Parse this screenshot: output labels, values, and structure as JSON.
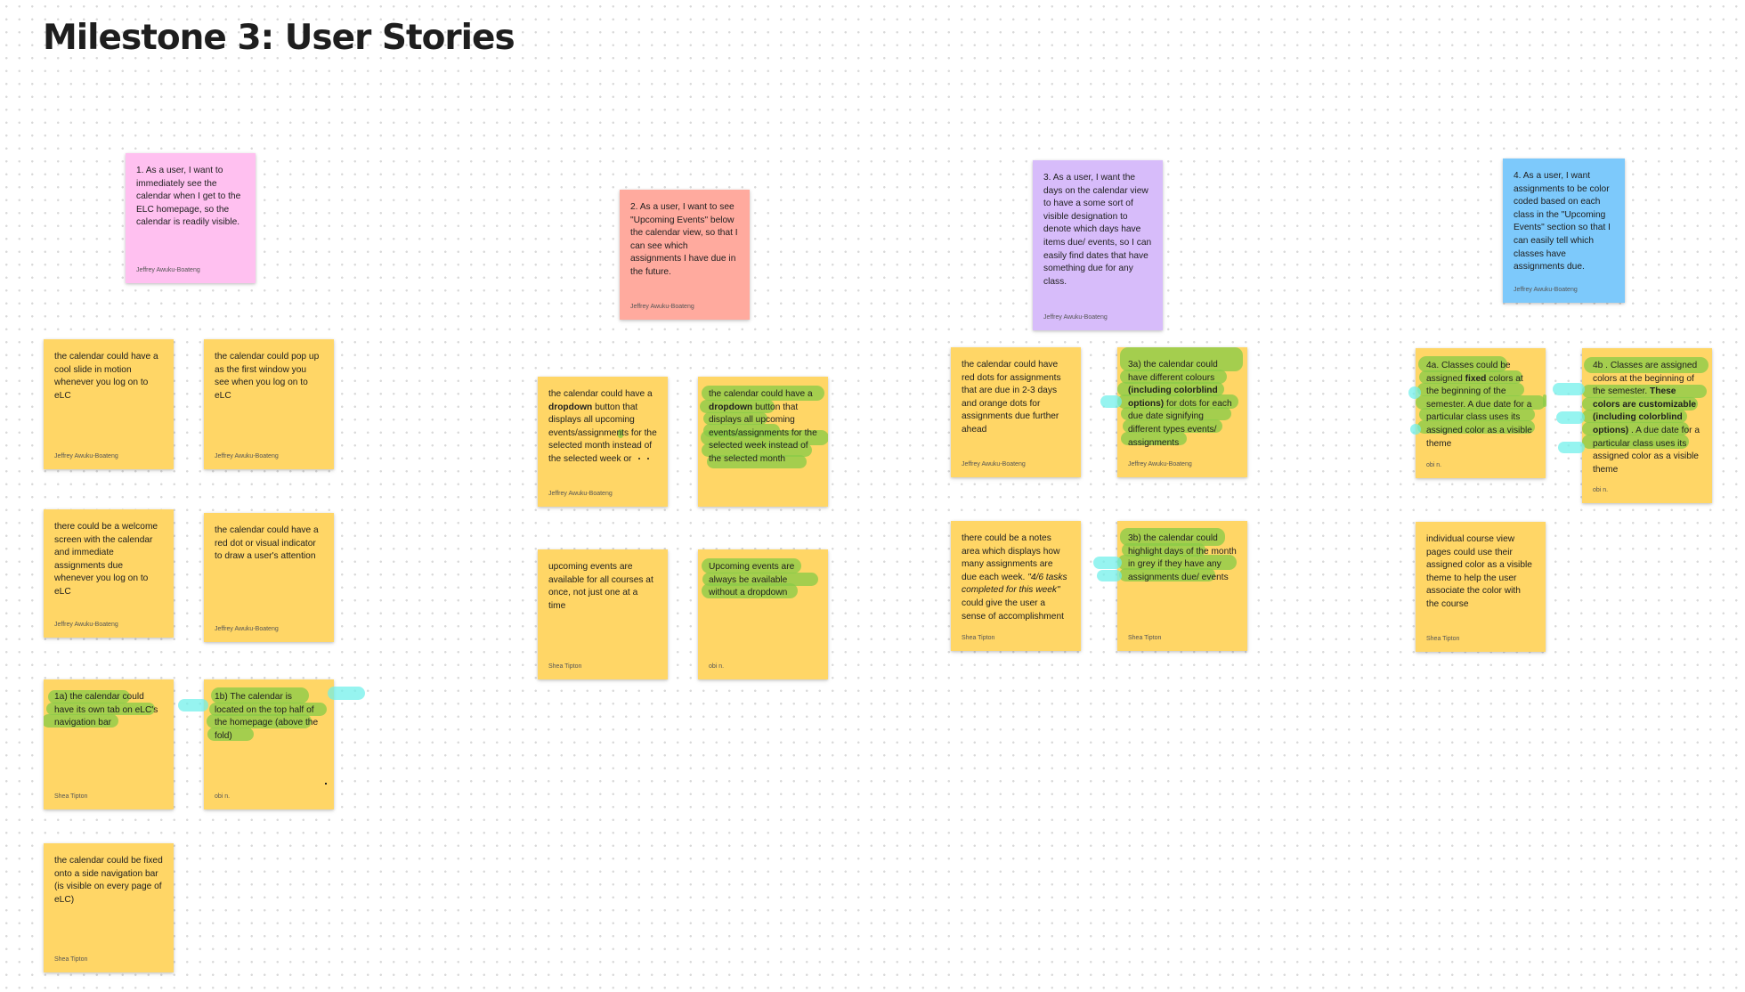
{
  "board": {
    "title": "Milestone 3: User Stories"
  },
  "stories": [
    {
      "text": "1. As a user, I want to immediately see the calendar when I get to the ELC homepage, so the calendar is readily visible.",
      "author": "Jeffrey Awuku-Boateng"
    },
    {
      "text": "2. As a user, I want to see \"Upcoming Events\" below the calendar view, so that I can see which assignments I have due in the future.",
      "author": "Jeffrey Awuku-Boateng"
    },
    {
      "text": "3. As a user, I want the days on the calendar view to have a some sort of visible designation to denote which days have items due/ events, so I can easily find dates that have something due for any class.",
      "author": "Jeffrey Awuku-Boateng"
    },
    {
      "text": "4. As a user, I want assignments to be color coded based on each class in the \"Upcoming Events\" section so that I can easily tell which classes have assignments due.",
      "author": "Jeffrey Awuku-Boateng"
    }
  ],
  "ideas": {
    "s1": [
      {
        "text": "the calendar could have a cool slide in motion whenever you log on to eLC",
        "author": "Jeffrey Awuku-Boateng"
      },
      {
        "text": "the calendar could pop up as the first window you see when you log on to eLC",
        "author": "Jeffrey Awuku-Boateng"
      },
      {
        "text": "there could be a welcome screen with the calendar and immediate assignments due whenever you log on to eLC",
        "author": "Jeffrey Awuku-Boateng"
      },
      {
        "text": "the calendar could have a red dot or visual indicator to draw a user's attention",
        "author": "Jeffrey Awuku-Boateng"
      },
      {
        "text": "1a) the calendar could have its own tab on eLC's navigation bar",
        "author": "Shea Tipton"
      },
      {
        "text": "1b) The calendar is located on the top half of the homepage (above the fold)",
        "author": "obi n."
      },
      {
        "text": "the calendar could be fixed onto a side navigation bar (is visible on every page of eLC)",
        "author": "Shea Tipton"
      }
    ],
    "s2": [
      {
        "pre": "the calendar could have a ",
        "bold": "dropdown",
        "post": " button that displays all upcoming events/assignments for the selected month instead of the selected week or",
        "author": "Jeffrey Awuku-Boateng"
      },
      {
        "pre": "the calendar could have a ",
        "bold": "dropdown",
        "post": " button that displays all upcoming events/assignments for the selected week instead of the selected month",
        "author": ""
      },
      {
        "text": "upcoming events are available for all courses at once, not just one at a time",
        "author": "Shea Tipton"
      },
      {
        "text": "Upcoming events are always be available without a dropdown",
        "author": "obi n."
      }
    ],
    "s3": [
      {
        "text": "the calendar could have red dots for assignments that are due in 2-3 days and orange dots for assignments due further ahead",
        "author": "Jeffrey Awuku-Boateng"
      },
      {
        "pre": "3a) the calendar could have different colours ",
        "bold": "(including colorblind options)",
        "post": " for dots for each due date signifying different types events/ assignments",
        "author": "Jeffrey Awuku-Boateng"
      },
      {
        "pre": "there could be a notes area which displays how many assignments are due each week. ",
        "italic": "\"4/6 tasks completed for this week\"",
        "post": " could give the user a sense of accomplishment",
        "author": "Shea Tipton"
      },
      {
        "text": "3b) the calendar could highlight days of the month in grey if they have any assignments due/ events",
        "author": "Shea Tipton"
      }
    ],
    "s4": [
      {
        "pre": "4a. Classes could be assigned ",
        "bold": "fixed",
        "post": " colors at the beginning of the semester. A due date for a particular class uses its assigned color as a visible theme",
        "author": "obi n."
      },
      {
        "pre": "4b . Classes are assigned colors at the beginning of the semester. ",
        "bold": "These colors are customizable (including colorblind options)",
        "post": " . A due date for a particular class uses its assigned color as a visible theme",
        "author": "obi n."
      },
      {
        "text": "individual course view pages could use their assigned color as a visible theme to help the user associate the color with the course",
        "author": "Shea Tipton"
      }
    ]
  },
  "colors": {
    "sticky_yellow": "#ffd666",
    "sticky_pink": "#ffc0f0",
    "sticky_salmon": "#ffaa9e",
    "sticky_purple": "#d7bcfa",
    "sticky_blue": "#7dc9fb",
    "highlight_green": "#8acc48",
    "highlight_cyan": "#6ef0ea"
  }
}
